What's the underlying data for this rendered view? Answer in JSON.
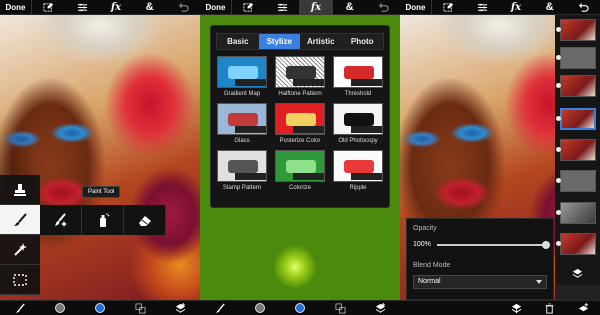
{
  "toolbar": {
    "done_label": "Done",
    "fx_label": "fx",
    "amp_label": "&"
  },
  "panel1": {
    "tooltip": "Paint Tool"
  },
  "filters": {
    "tabs": [
      {
        "label": "Basic",
        "active": false
      },
      {
        "label": "Stylize",
        "active": true
      },
      {
        "label": "Artistic",
        "active": false
      },
      {
        "label": "Photo",
        "active": false
      }
    ],
    "items": [
      {
        "label": "Gradient Map",
        "color": "#2aa3e0"
      },
      {
        "label": "Halftone Pattern",
        "color": "#cfcfcf"
      },
      {
        "label": "Threshold",
        "color": "#d42a2a"
      },
      {
        "label": "Glass",
        "color": "#5a8cd0"
      },
      {
        "label": "Posterize Color",
        "color": "#e02020"
      },
      {
        "label": "Old Photocopy",
        "color": "#f4f4f4"
      },
      {
        "label": "Stamp Pattern",
        "color": "#d8d8d8"
      },
      {
        "label": "Colorize",
        "color": "#2f9a3a"
      },
      {
        "label": "Ripple",
        "color": "#e83a3a"
      }
    ]
  },
  "layers_panel": {
    "opacity_label": "Opacity",
    "opacity_value": "100%",
    "opacity_fraction": 1.0,
    "blend_mode_label": "Blend Mode",
    "blend_mode_value": "Normal"
  },
  "colors": {
    "accent": "#3b7fe0",
    "background_swatch": "#777777",
    "foreground_swatch": "#1f6fe0"
  }
}
